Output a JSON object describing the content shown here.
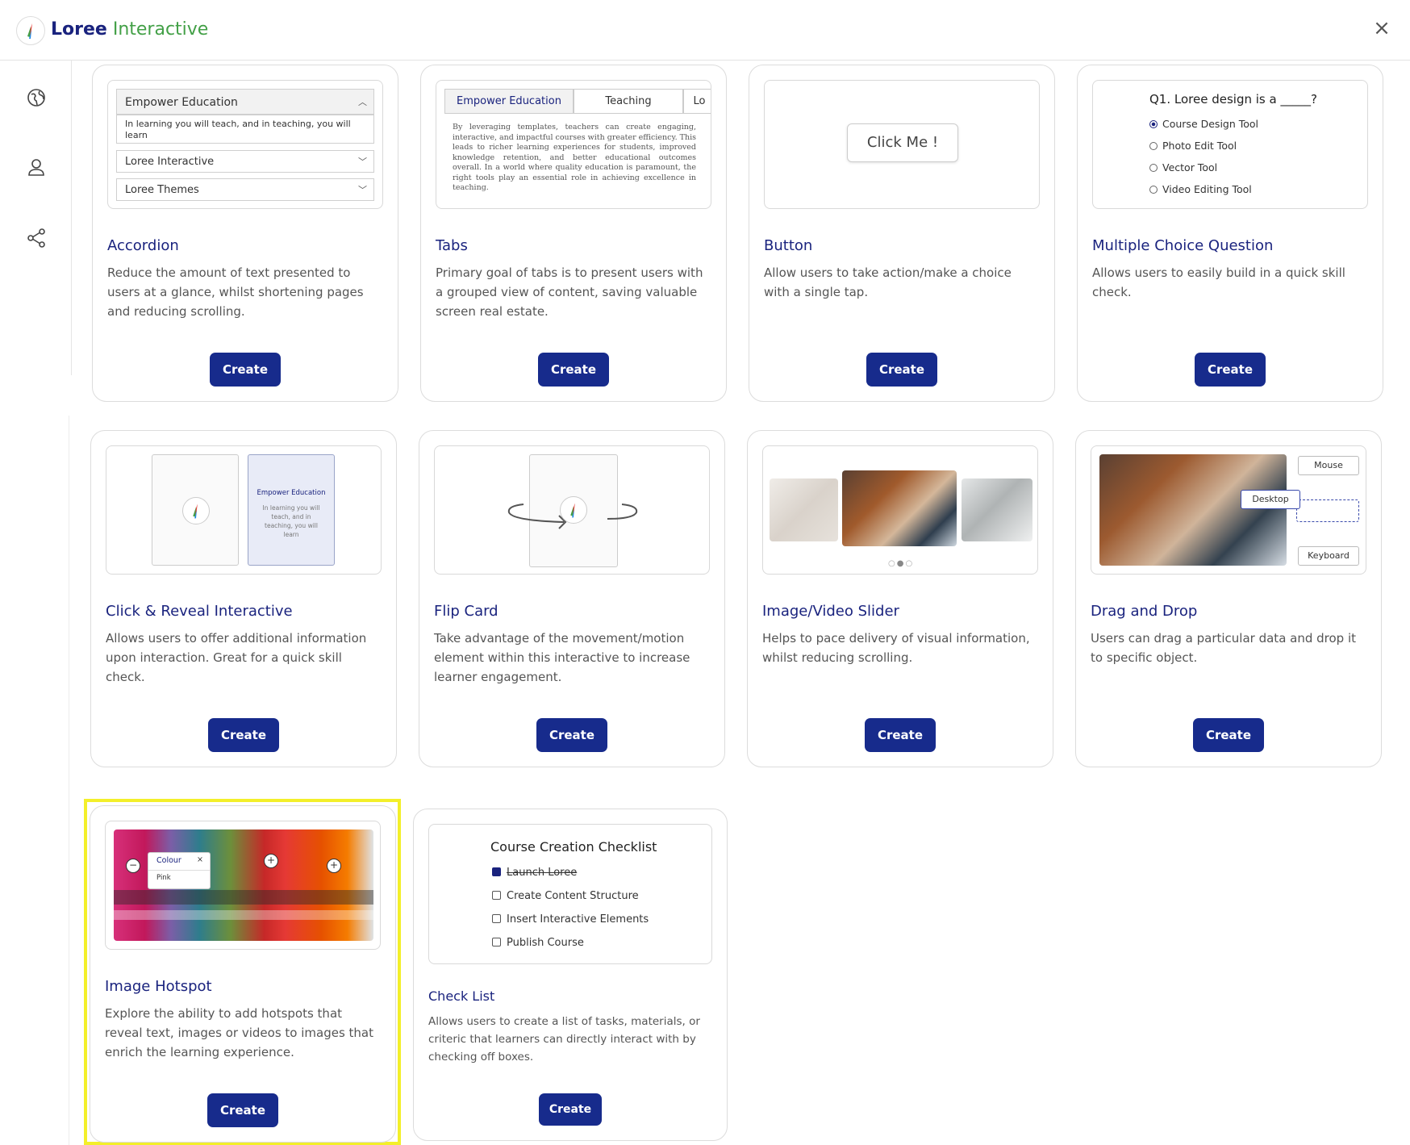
{
  "header": {
    "brand_primary": "Loree",
    "brand_secondary": "Interactive",
    "close_glyph": "×"
  },
  "sidebar": {
    "icons": [
      "globe-icon",
      "user-icon",
      "share-icon"
    ]
  },
  "colors": {
    "brand_blue": "#1a237e",
    "brand_green": "#43a047",
    "button": "#172b8c",
    "highlight": "#f3ef2a"
  },
  "cards": [
    {
      "title": "Accordion",
      "desc": "Reduce the amount of text presented to users at a glance, whilst shortening pages and reducing scrolling.",
      "button": "Create"
    },
    {
      "title": "Tabs",
      "desc": "Primary goal of tabs is to present users with a grouped view of content, saving valuable screen real estate.",
      "button": "Create"
    },
    {
      "title": "Button",
      "desc": "Allow users to take action/make a choice with a single tap.",
      "button": "Create"
    },
    {
      "title": "Multiple Choice Question",
      "desc": "Allows users to easily build in a quick skill check.",
      "button": "Create"
    },
    {
      "title": "Click & Reveal Interactive",
      "desc": "Allows users to offer additional information upon interaction. Great for a quick skill check.",
      "button": "Create"
    },
    {
      "title": "Flip Card",
      "desc": "Take advantage of the movement/motion element within this interactive to increase learner engagement.",
      "button": "Create"
    },
    {
      "title": "Image/Video Slider",
      "desc": "Helps to pace delivery of visual information, whilst reducing scrolling.",
      "button": "Create"
    },
    {
      "title": "Drag and Drop",
      "desc": "Users can drag a particular data and drop it to specific object.",
      "button": "Create"
    },
    {
      "title": "Image Hotspot",
      "desc": "Explore the ability to add hotspots that reveal text, images or videos to images that enrich the learning experience.",
      "button": "Create"
    },
    {
      "title": "Check List",
      "desc": "Allows users to create a list of tasks, materials, or criteric that learners can directly interact with by checking off boxes.",
      "button": "Create"
    }
  ],
  "accordion_preview": {
    "open_title": "Empower Education",
    "open_body": "In learning you will teach, and in teaching, you will learn",
    "closed": [
      "Loree Interactive",
      "Loree Themes"
    ]
  },
  "tabs_preview": {
    "tabs": [
      "Empower Education",
      "Teaching",
      "Lo"
    ],
    "body": "By leveraging templates, teachers can create engaging, interactive, and impactful courses with greater efficiency. This leads to richer learning experiences for students, improved knowledge retention, and better educational outcomes overall. In a world where quality education is paramount, the right tools play an essential role in achieving excellence in teaching."
  },
  "button_preview": {
    "label": "Click Me !"
  },
  "mcq_preview": {
    "question": "Q1. Loree design is a _____?",
    "options": [
      "Course Design Tool",
      "Photo Edit Tool",
      "Vector Tool",
      "Video Editing Tool"
    ],
    "selected_index": 0
  },
  "reveal_preview": {
    "title": "Empower Education",
    "body": "In learning you will teach, and in teaching, you will learn"
  },
  "slider_preview": {
    "dots": 3,
    "active_dot": 1
  },
  "dnd_preview": {
    "labels": [
      "Mouse",
      "Desktop",
      "Keyboard"
    ]
  },
  "hotspot_preview": {
    "popup_title": "Colour",
    "popup_value": "Pink",
    "popup_close": "×"
  },
  "checklist_preview": {
    "title": "Course Creation Checklist",
    "items": [
      {
        "label": "Launch Loree",
        "checked": true
      },
      {
        "label": "Create Content Structure",
        "checked": false
      },
      {
        "label": "Insert Interactive Elements",
        "checked": false
      },
      {
        "label": "Publish Course",
        "checked": false
      }
    ]
  }
}
